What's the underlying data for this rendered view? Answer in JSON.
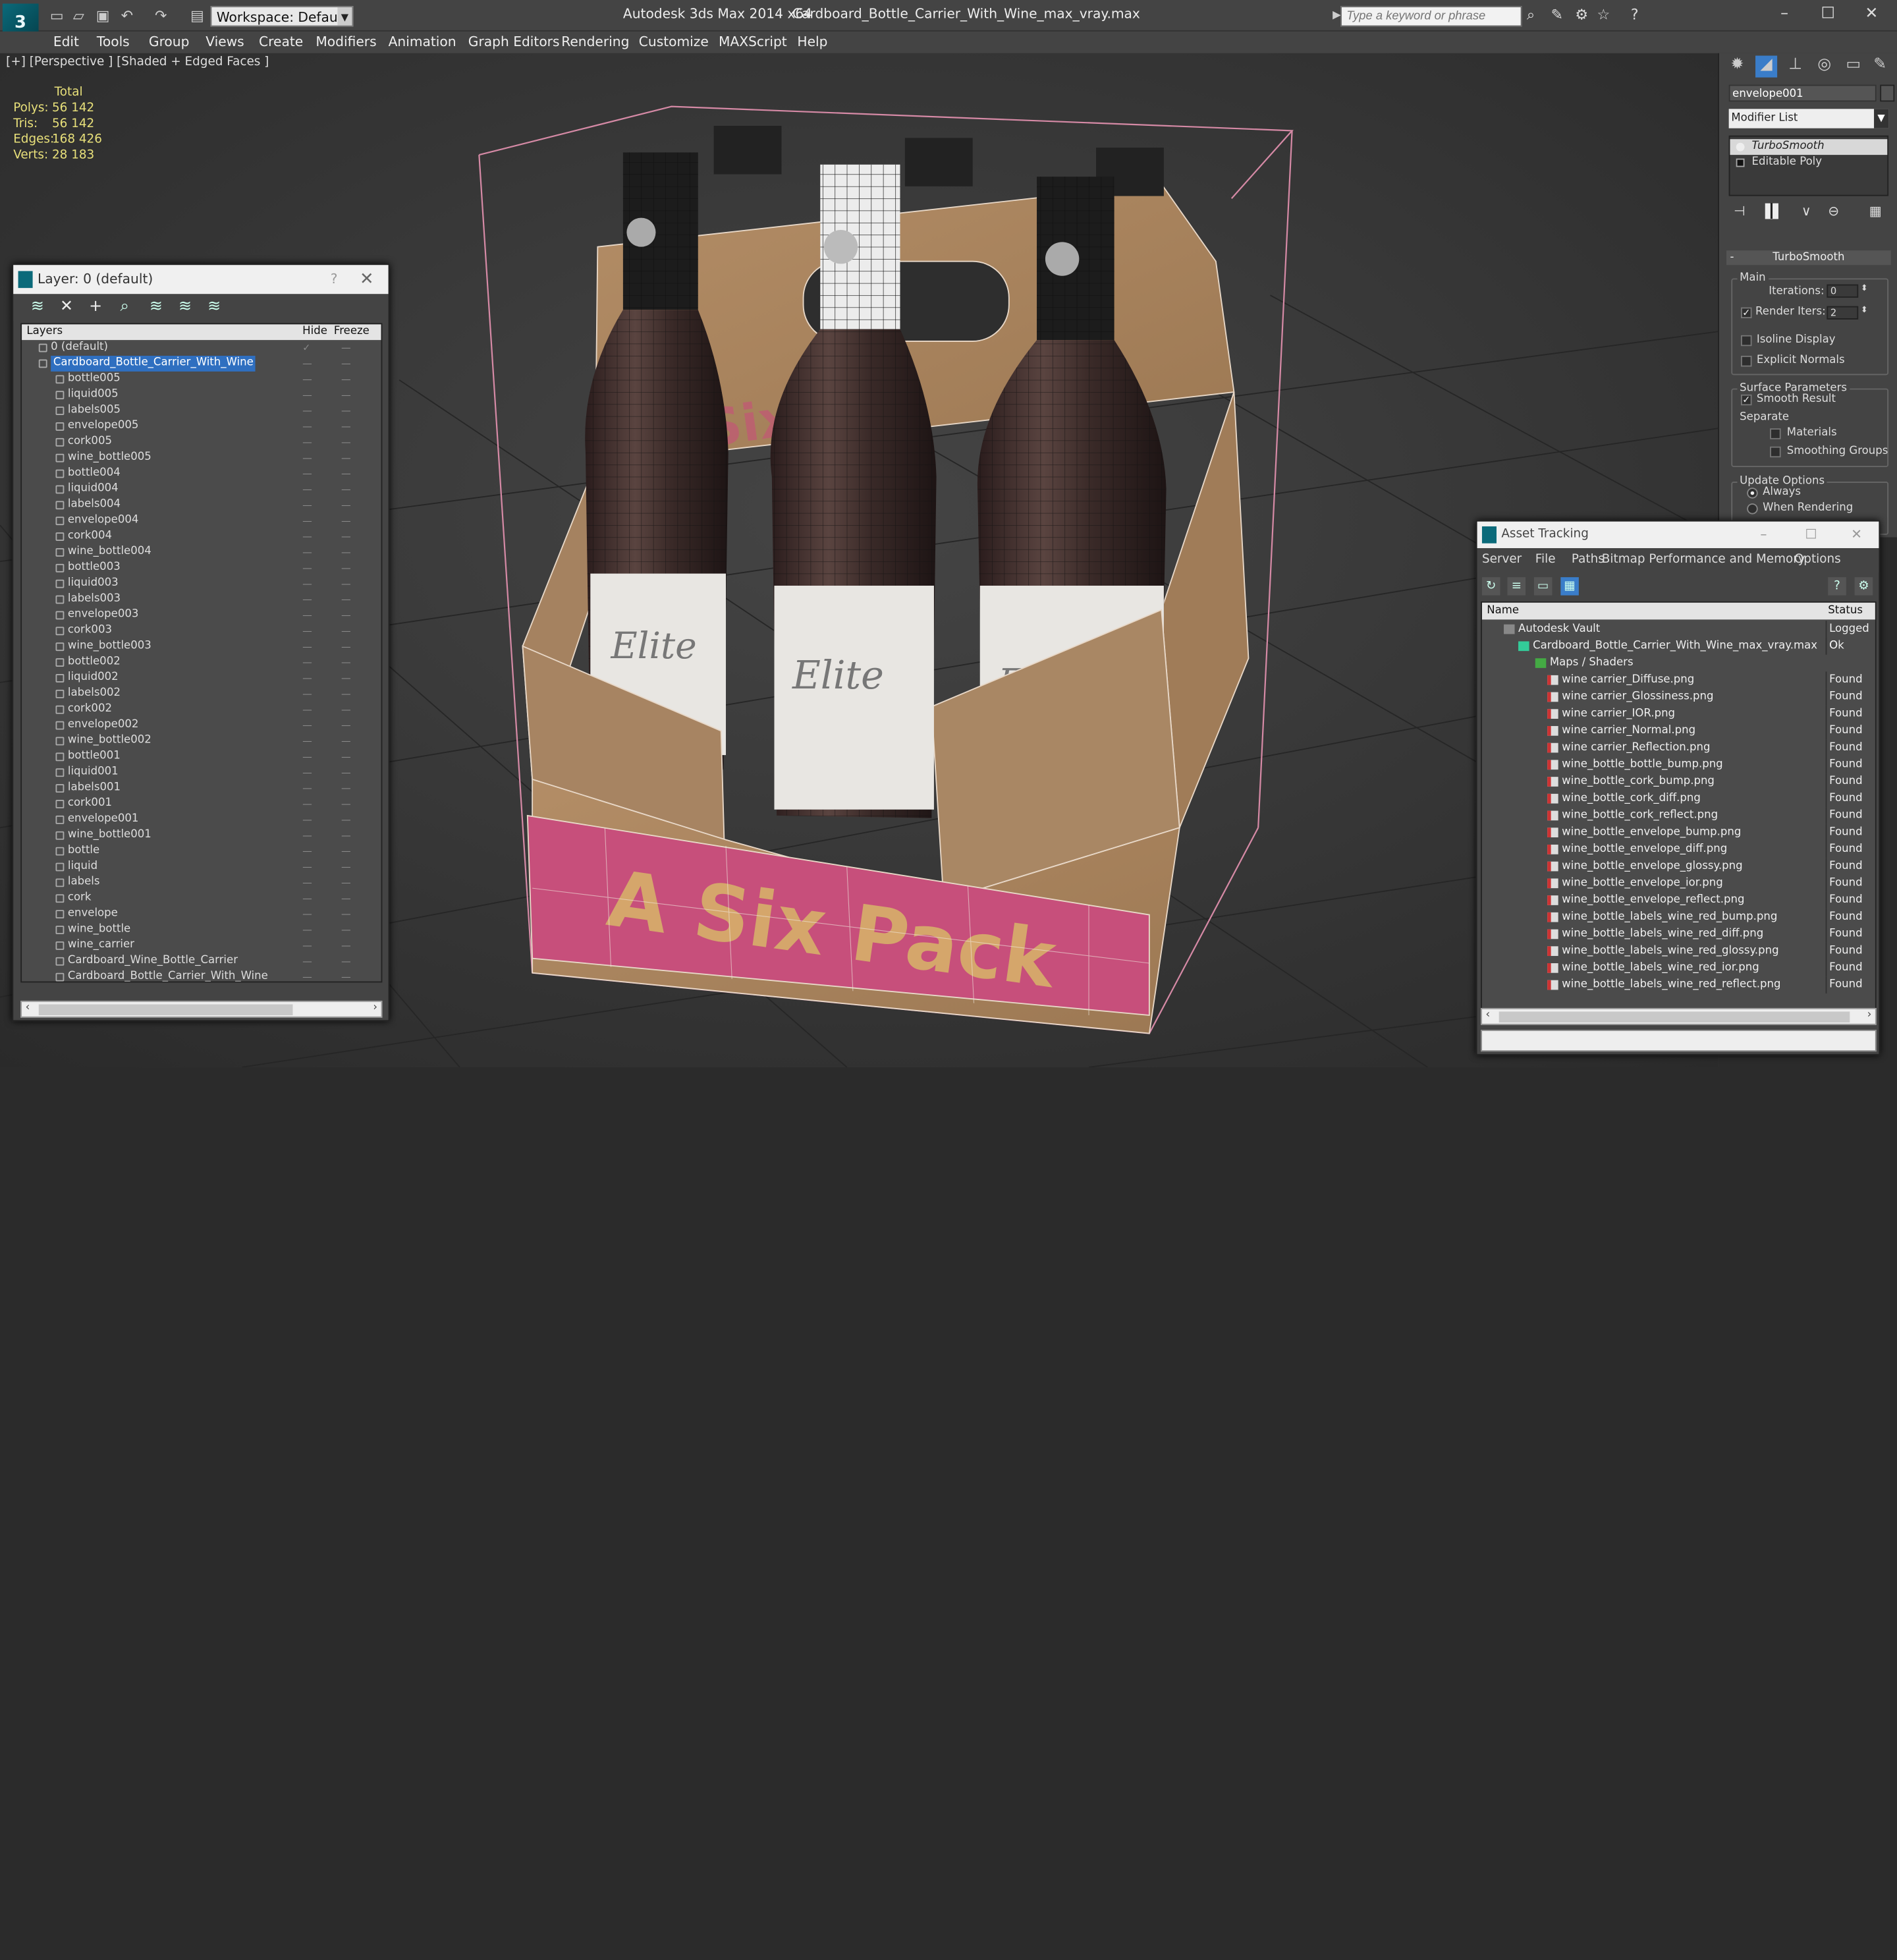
{
  "window": {
    "app_title": "Autodesk 3ds Max  2014 x64",
    "file_title": "Cardboard_Bottle_Carrier_With_Wine_max_vray.max",
    "workspace_label": "Workspace: Default",
    "search_placeholder": "Type a keyword or phrase",
    "controls": [
      "–",
      "☐",
      "✕"
    ]
  },
  "menu": [
    "Edit",
    "Tools",
    "Group",
    "Views",
    "Create",
    "Modifiers",
    "Animation",
    "Graph Editors",
    "Rendering",
    "Customize",
    "MAXScript",
    "Help"
  ],
  "viewport": {
    "label": "[+] [Perspective ] [Shaded + Edged Faces ]",
    "stats": {
      "header": "Total",
      "rows": [
        {
          "label": "Polys:",
          "value": "56 142"
        },
        {
          "label": "Tris:",
          "value": "56 142"
        },
        {
          "label": "Edges:",
          "value": "168 426"
        },
        {
          "label": "Verts:",
          "value": "28 183"
        }
      ]
    },
    "carton_text_front": "A Six Pack",
    "label_text": "Elite"
  },
  "layer_panel": {
    "title": "Layer: 0 (default)",
    "help": "?",
    "columns": [
      "Layers",
      "Hide",
      "Freeze"
    ],
    "rows": [
      {
        "name": "0 (default)",
        "level": 0,
        "hide": "✓",
        "freeze": "—"
      },
      {
        "name": "Cardboard_Bottle_Carrier_With_Wine",
        "level": 0,
        "selected": true,
        "hide": "—",
        "freeze": "—"
      },
      {
        "name": "bottle005",
        "level": 1
      },
      {
        "name": "liquid005",
        "level": 1
      },
      {
        "name": "labels005",
        "level": 1
      },
      {
        "name": "envelope005",
        "level": 1
      },
      {
        "name": "cork005",
        "level": 1
      },
      {
        "name": "wine_bottle005",
        "level": 1
      },
      {
        "name": "bottle004",
        "level": 1
      },
      {
        "name": "liquid004",
        "level": 1
      },
      {
        "name": "labels004",
        "level": 1
      },
      {
        "name": "envelope004",
        "level": 1
      },
      {
        "name": "cork004",
        "level": 1
      },
      {
        "name": "wine_bottle004",
        "level": 1
      },
      {
        "name": "bottle003",
        "level": 1
      },
      {
        "name": "liquid003",
        "level": 1
      },
      {
        "name": "labels003",
        "level": 1
      },
      {
        "name": "envelope003",
        "level": 1
      },
      {
        "name": "cork003",
        "level": 1
      },
      {
        "name": "wine_bottle003",
        "level": 1
      },
      {
        "name": "bottle002",
        "level": 1
      },
      {
        "name": "liquid002",
        "level": 1
      },
      {
        "name": "labels002",
        "level": 1
      },
      {
        "name": "cork002",
        "level": 1
      },
      {
        "name": "envelope002",
        "level": 1
      },
      {
        "name": "wine_bottle002",
        "level": 1
      },
      {
        "name": "bottle001",
        "level": 1
      },
      {
        "name": "liquid001",
        "level": 1
      },
      {
        "name": "labels001",
        "level": 1
      },
      {
        "name": "cork001",
        "level": 1
      },
      {
        "name": "envelope001",
        "level": 1
      },
      {
        "name": "wine_bottle001",
        "level": 1
      },
      {
        "name": "bottle",
        "level": 1
      },
      {
        "name": "liquid",
        "level": 1
      },
      {
        "name": "labels",
        "level": 1
      },
      {
        "name": "cork",
        "level": 1
      },
      {
        "name": "envelope",
        "level": 1
      },
      {
        "name": "wine_bottle",
        "level": 1
      },
      {
        "name": "wine_carrier",
        "level": 1
      },
      {
        "name": "Cardboard_Wine_Bottle_Carrier",
        "level": 1
      },
      {
        "name": "Cardboard_Bottle_Carrier_With_Wine",
        "level": 1
      }
    ]
  },
  "command_panel": {
    "object_name": "envelope001",
    "modifier_list": "Modifier List",
    "stack": [
      "TurboSmooth",
      "Editable Poly"
    ],
    "rollout_title": "TurboSmooth",
    "main_group": "Main",
    "iterations_label": "Iterations:",
    "iterations_value": "0",
    "render_iters_label": "Render Iters:",
    "render_iters_value": "2",
    "render_iters_checked": true,
    "isoline_label": "Isoline Display",
    "explicit_normals_label": "Explicit Normals",
    "surface_group": "Surface Parameters",
    "smooth_result_label": "Smooth Result",
    "separate_label": "Separate",
    "materials_label": "Materials",
    "smoothing_groups_label": "Smoothing Groups",
    "update_group": "Update Options",
    "always_label": "Always",
    "when_rendering_label": "When Rendering"
  },
  "asset_tracking": {
    "title": "Asset Tracking",
    "menu": [
      "Server",
      "File",
      "Paths",
      "Bitmap Performance and Memory",
      "Options"
    ],
    "columns": [
      "Name",
      "Status"
    ],
    "rows": [
      {
        "name": "Autodesk Vault",
        "status": "Logged O",
        "level": 0,
        "type": "vault"
      },
      {
        "name": "Cardboard_Bottle_Carrier_With_Wine_max_vray.max",
        "status": "Ok",
        "level": 1,
        "type": "max"
      },
      {
        "name": "Maps / Shaders",
        "status": "",
        "level": 2,
        "type": "folder"
      },
      {
        "name": "wine carrier_Diffuse.png",
        "status": "Found",
        "level": 3,
        "type": "png"
      },
      {
        "name": "wine carrier_Glossiness.png",
        "status": "Found",
        "level": 3,
        "type": "png"
      },
      {
        "name": "wine carrier_IOR.png",
        "status": "Found",
        "level": 3,
        "type": "png"
      },
      {
        "name": "wine carrier_Normal.png",
        "status": "Found",
        "level": 3,
        "type": "png"
      },
      {
        "name": "wine carrier_Reflection.png",
        "status": "Found",
        "level": 3,
        "type": "png"
      },
      {
        "name": "wine_bottle_bottle_bump.png",
        "status": "Found",
        "level": 3,
        "type": "png"
      },
      {
        "name": "wine_bottle_cork_bump.png",
        "status": "Found",
        "level": 3,
        "type": "png"
      },
      {
        "name": "wine_bottle_cork_diff.png",
        "status": "Found",
        "level": 3,
        "type": "png"
      },
      {
        "name": "wine_bottle_cork_reflect.png",
        "status": "Found",
        "level": 3,
        "type": "png"
      },
      {
        "name": "wine_bottle_envelope_bump.png",
        "status": "Found",
        "level": 3,
        "type": "png"
      },
      {
        "name": "wine_bottle_envelope_diff.png",
        "status": "Found",
        "level": 3,
        "type": "png"
      },
      {
        "name": "wine_bottle_envelope_glossy.png",
        "status": "Found",
        "level": 3,
        "type": "png"
      },
      {
        "name": "wine_bottle_envelope_ior.png",
        "status": "Found",
        "level": 3,
        "type": "png"
      },
      {
        "name": "wine_bottle_envelope_reflect.png",
        "status": "Found",
        "level": 3,
        "type": "png"
      },
      {
        "name": "wine_bottle_labels_wine_red_bump.png",
        "status": "Found",
        "level": 3,
        "type": "png"
      },
      {
        "name": "wine_bottle_labels_wine_red_diff.png",
        "status": "Found",
        "level": 3,
        "type": "png"
      },
      {
        "name": "wine_bottle_labels_wine_red_glossy.png",
        "status": "Found",
        "level": 3,
        "type": "png"
      },
      {
        "name": "wine_bottle_labels_wine_red_ior.png",
        "status": "Found",
        "level": 3,
        "type": "png"
      },
      {
        "name": "wine_bottle_labels_wine_red_reflect.png",
        "status": "Found",
        "level": 3,
        "type": "png"
      }
    ]
  }
}
